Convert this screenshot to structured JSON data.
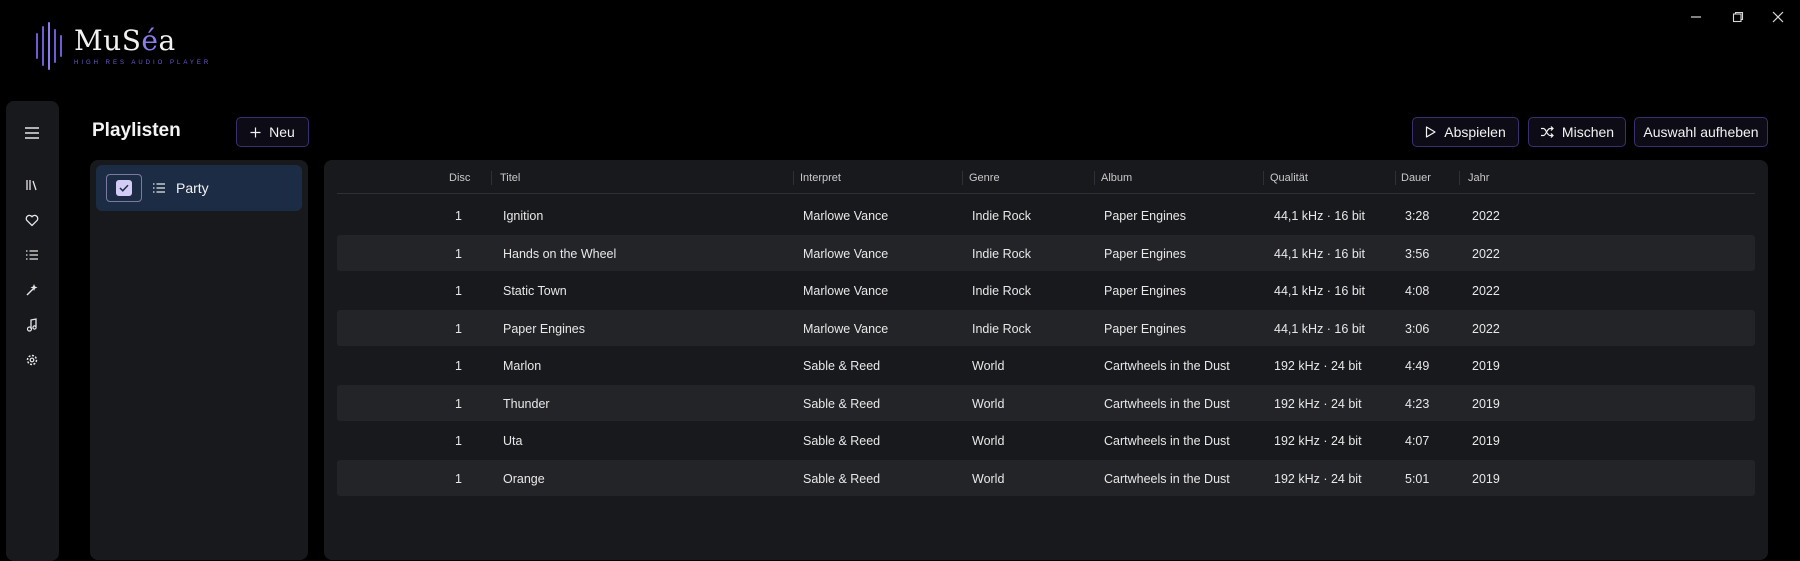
{
  "app": {
    "name_pre": "MuS",
    "name_accent": "é",
    "name_post": "a",
    "subtitle": "HIGH RES AUDIO PLAYER"
  },
  "window_controls": [
    {
      "icon": "minimize-icon"
    },
    {
      "icon": "restore-icon"
    },
    {
      "icon": "close-icon"
    }
  ],
  "nav": [
    {
      "icon": "hamburger-menu-icon"
    },
    {
      "icon": "library-icon"
    },
    {
      "icon": "heart-icon"
    },
    {
      "icon": "playlist-icon"
    },
    {
      "icon": "magic-wand-icon"
    },
    {
      "icon": "music-note-icon"
    },
    {
      "icon": "settings-gear-icon"
    }
  ],
  "header": {
    "title": "Playlisten",
    "new_button": "Neu",
    "play_button": "Abspielen",
    "shuffle_button": "Mischen",
    "clear_selection_button": "Auswahl aufheben"
  },
  "playlists": [
    {
      "name": "Party",
      "checked": true
    }
  ],
  "table": {
    "columns": [
      "Disc",
      "Titel",
      "Interpret",
      "Genre",
      "Album",
      "Qualität",
      "Dauer",
      "Jahr"
    ],
    "rows": [
      {
        "disc": "1",
        "title": "Ignition",
        "artist": "Marlowe Vance",
        "genre": "Indie Rock",
        "album": "Paper Engines",
        "quality": "44,1 kHz · 16 bit",
        "duration": "3:28",
        "year": "2022"
      },
      {
        "disc": "1",
        "title": "Hands on the Wheel",
        "artist": "Marlowe Vance",
        "genre": "Indie Rock",
        "album": "Paper Engines",
        "quality": "44,1 kHz · 16 bit",
        "duration": "3:56",
        "year": "2022"
      },
      {
        "disc": "1",
        "title": "Static Town",
        "artist": "Marlowe Vance",
        "genre": "Indie Rock",
        "album": "Paper Engines",
        "quality": "44,1 kHz · 16 bit",
        "duration": "4:08",
        "year": "2022"
      },
      {
        "disc": "1",
        "title": "Paper Engines",
        "artist": "Marlowe Vance",
        "genre": "Indie Rock",
        "album": "Paper Engines",
        "quality": "44,1 kHz · 16 bit",
        "duration": "3:06",
        "year": "2022"
      },
      {
        "disc": "1",
        "title": "Marlon",
        "artist": "Sable & Reed",
        "genre": "World",
        "album": "Cartwheels in the Dust",
        "quality": "192 kHz · 24 bit",
        "duration": "4:49",
        "year": "2019"
      },
      {
        "disc": "1",
        "title": "Thunder",
        "artist": "Sable & Reed",
        "genre": "World",
        "album": "Cartwheels in the Dust",
        "quality": "192 kHz · 24 bit",
        "duration": "4:23",
        "year": "2019"
      },
      {
        "disc": "1",
        "title": "Uta",
        "artist": "Sable & Reed",
        "genre": "World",
        "album": "Cartwheels in the Dust",
        "quality": "192 kHz · 24 bit",
        "duration": "4:07",
        "year": "2019"
      },
      {
        "disc": "1",
        "title": "Orange",
        "artist": "Sable & Reed",
        "genre": "World",
        "album": "Cartwheels in the Dust",
        "quality": "192 kHz · 24 bit",
        "duration": "5:01",
        "year": "2019"
      }
    ]
  },
  "colors": {
    "background": "#000000",
    "panel": "#18191d",
    "row_alt": "#232428",
    "selected_playlist": "#1d2c45",
    "accent": "#6f5bd6",
    "button_border": "#3a2f6f"
  }
}
